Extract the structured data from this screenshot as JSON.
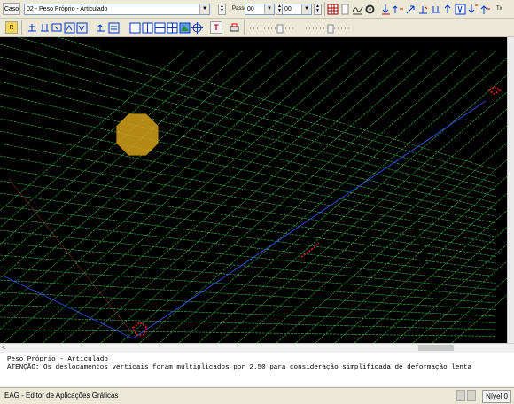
{
  "toolbar1": {
    "case_label": "Caso",
    "case_value": "02 - Peso Próprio - Articulado",
    "step_label": "Passo",
    "step_value": "00",
    "sub_value": "00",
    "trailing_label": "Tx"
  },
  "toolbar2": {
    "r_button": "R",
    "t_button": "T"
  },
  "viewport": {
    "background": "#000000",
    "grid_color": "#39b54a",
    "axis_color": "#2a4bd7",
    "highlight_color": "#d4a017",
    "marker_color": "#e02020"
  },
  "scroll": {
    "left_arrow": "<"
  },
  "messages": {
    "line1": "Peso Próprio - Articulado",
    "line2": "ATENÇÃO: Os deslocamentos verticais foram multiplicados por 2.50 para consideração simplificada de deformação lenta"
  },
  "status": {
    "app_name": "EAG - Editor de Aplicações Gráficas",
    "level": "Nível 0"
  }
}
